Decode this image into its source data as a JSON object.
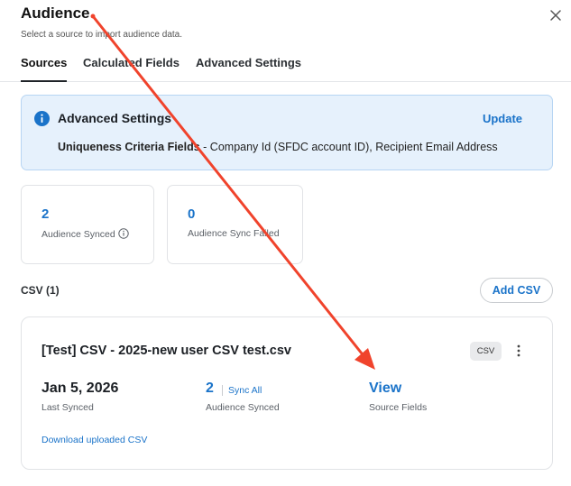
{
  "header": {
    "title": "Audience",
    "subtitle": "Select a source to import audience data."
  },
  "tabs": [
    {
      "label": "Sources",
      "active": true
    },
    {
      "label": "Calculated Fields",
      "active": false
    },
    {
      "label": "Advanced Settings",
      "active": false
    }
  ],
  "banner": {
    "icon": "info-icon",
    "title": "Advanced Settings",
    "action_label": "Update",
    "criteria_label": "Uniqueness Criteria Fields",
    "criteria_separator": " - ",
    "criteria_value": "Company Id (SFDC account ID), Recipient Email Address"
  },
  "stats": [
    {
      "value": "2",
      "label": "Audience Synced",
      "has_info": true
    },
    {
      "value": "0",
      "label": "Audience Sync Failed",
      "has_info": false
    }
  ],
  "csv_section": {
    "title": "CSV (1)",
    "add_label": "Add CSV",
    "item": {
      "name": "[Test] CSV - 2025-new user CSV test.csv",
      "badge": "CSV",
      "last_synced_value": "Jan 5, 2026",
      "last_synced_label": "Last Synced",
      "audience_synced_value": "2",
      "sync_all_label": "Sync All",
      "audience_synced_label": "Audience Synced",
      "source_fields_value": "View",
      "source_fields_label": "Source Fields",
      "download_label": "Download uploaded CSV"
    }
  },
  "colors": {
    "accent": "#1a73c9",
    "banner_bg": "#e6f1fc",
    "annotation_arrow": "#f0432c"
  }
}
